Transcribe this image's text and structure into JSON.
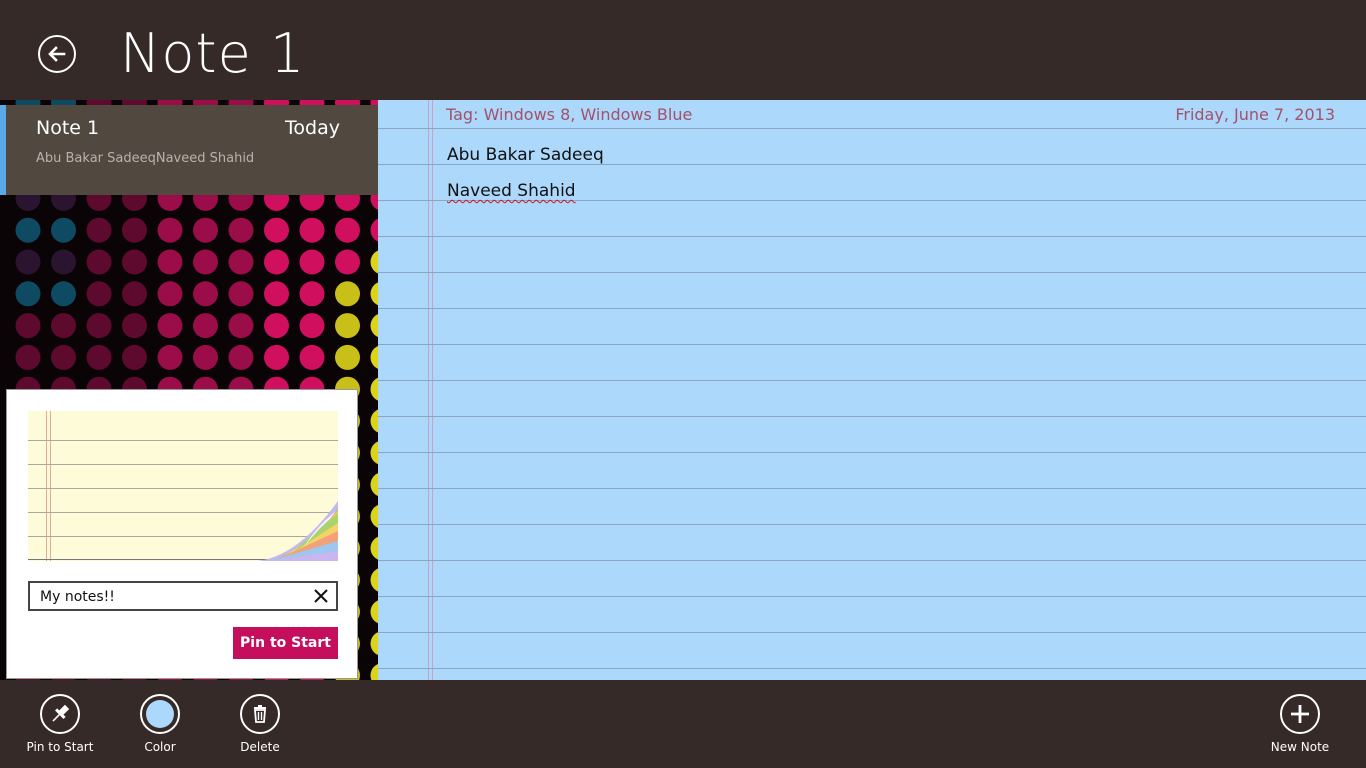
{
  "header": {
    "title": "Note 1"
  },
  "note_list": [
    {
      "title": "Note 1",
      "date": "Today",
      "preview": "Abu Bakar SadeeqNaveed Shahid"
    }
  ],
  "pin_flyout": {
    "tile_name_value": "My notes!!",
    "pin_button_label": "Pin to Start"
  },
  "note": {
    "tag": "Tag: Windows 8, Windows Blue",
    "date": "Friday, June 7, 2013",
    "lines": [
      "Abu Bakar Sadeeq",
      "Naveed Shahid"
    ]
  },
  "appbar": {
    "pin_label": "Pin to Start",
    "color_label": "Color",
    "delete_label": "Delete",
    "new_note_label": "New Note"
  },
  "colors": {
    "accent_pink": "#c50f5d",
    "paper_blue": "#acd8fc",
    "chrome_brown": "#352a27",
    "tag_text": "#a4516a"
  }
}
